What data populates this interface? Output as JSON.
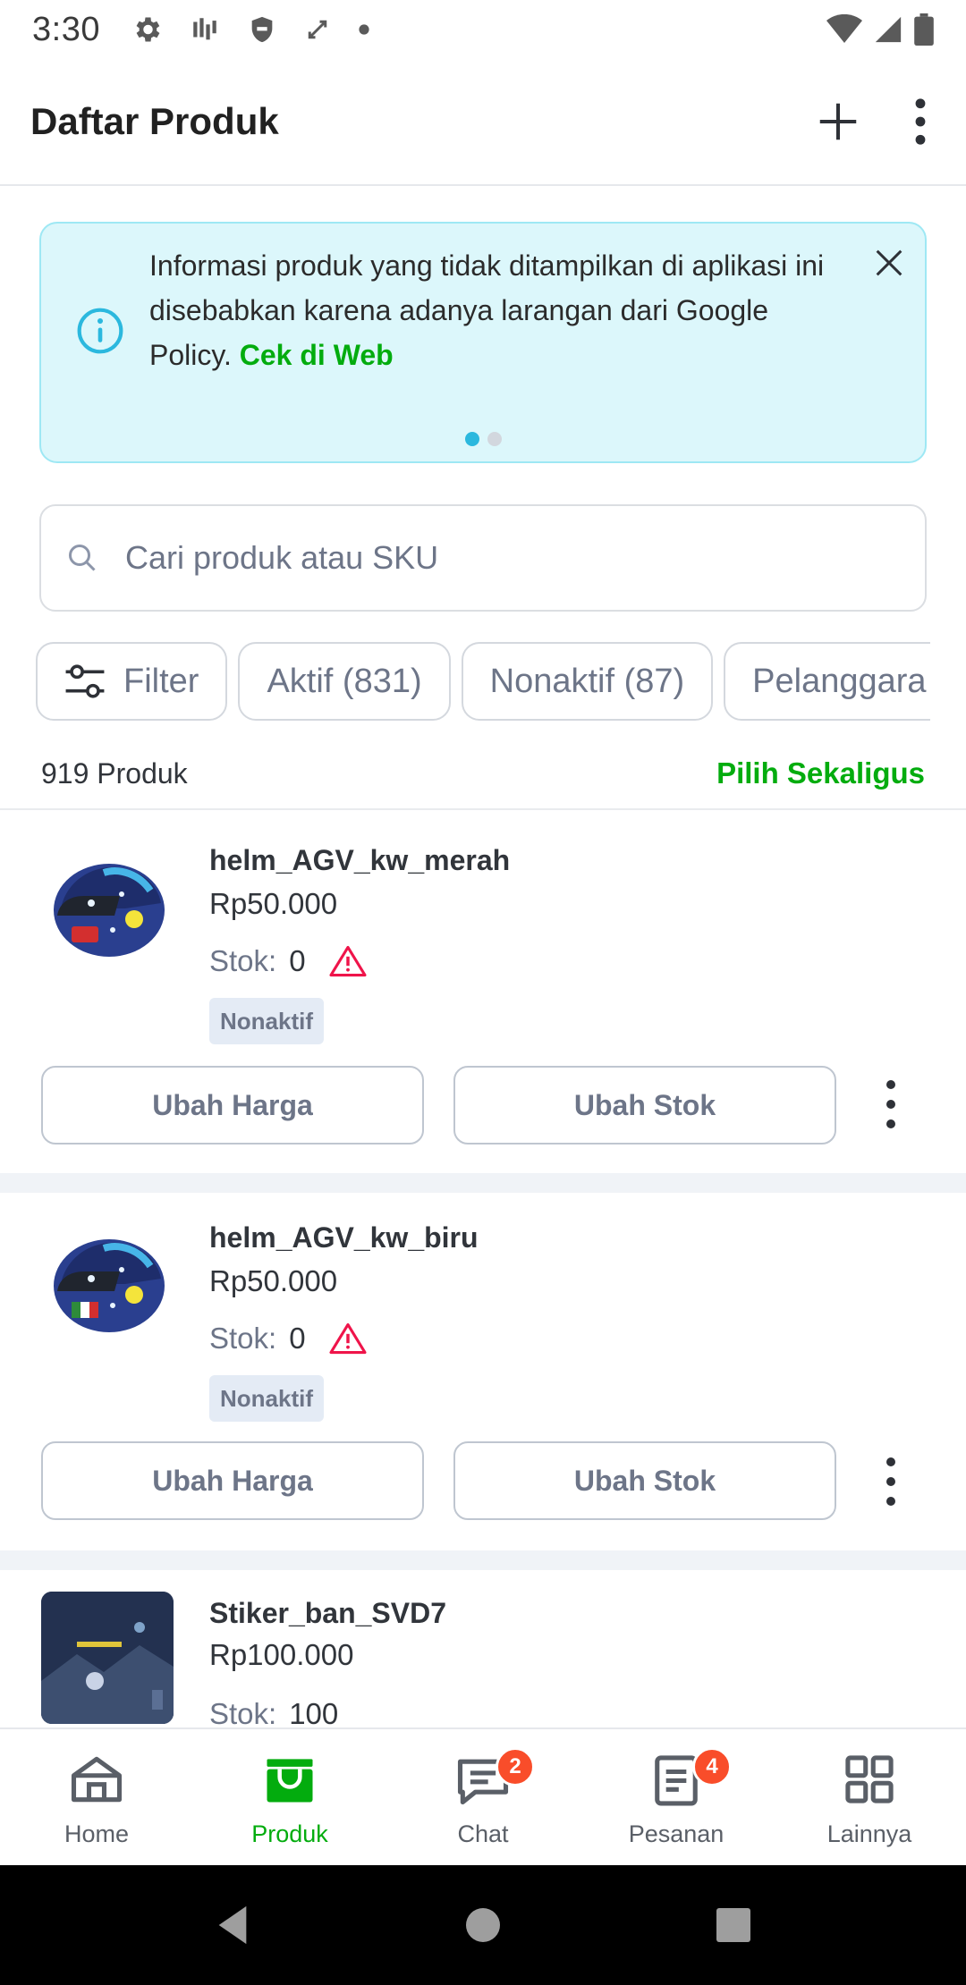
{
  "status_bar": {
    "time": "3:30",
    "icons": [
      "settings-icon",
      "signal-bars-icon",
      "shield-icon",
      "sync-icon",
      "dot-icon",
      "wifi-icon",
      "cell-signal-icon",
      "battery-icon"
    ]
  },
  "app_bar": {
    "title": "Daftar Produk",
    "add_icon": "plus-icon",
    "menu_icon": "more-vert-icon"
  },
  "banner": {
    "text": "Informasi produk yang tidak ditampilkan di aplikasi ini disebabkan karena adanya larangan dari Google Policy.",
    "link": "Cek di Web",
    "page_count": 2,
    "active_page": 1,
    "colors": {
      "background": "#dcf7fb",
      "accent": "#2bb8de",
      "link": "#03ac0e"
    }
  },
  "search": {
    "placeholder": "Cari produk atau SKU",
    "value": ""
  },
  "chips": [
    {
      "label": "Filter",
      "icon": "sliders-icon"
    },
    {
      "label": "Aktif (831)"
    },
    {
      "label": "Nonaktif (87)"
    },
    {
      "label": "Pelanggara"
    }
  ],
  "summary": {
    "count": "919 Produk",
    "select_all": "Pilih Sekaligus"
  },
  "products": [
    {
      "name": "helm_AGV_kw_merah",
      "price": "Rp50.000",
      "stock_label": "Stok:",
      "stock_value": "0",
      "status": "Nonaktif",
      "edit_price": "Ubah Harga",
      "edit_stock": "Ubah Stok"
    },
    {
      "name": "helm_AGV_kw_biru",
      "price": "Rp50.000",
      "stock_label": "Stok:",
      "stock_value": "0",
      "status": "Nonaktif",
      "edit_price": "Ubah Harga",
      "edit_stock": "Ubah Stok"
    },
    {
      "name": "Stiker_ban_SVD7",
      "price": "Rp100.000",
      "stock_label": "Stok:",
      "stock_value": "100"
    }
  ],
  "bottom_nav": [
    {
      "label": "Home",
      "icon": "home-icon"
    },
    {
      "label": "Produk",
      "icon": "store-icon",
      "active": true
    },
    {
      "label": "Chat",
      "icon": "chat-icon",
      "badge": "2"
    },
    {
      "label": "Pesanan",
      "icon": "orders-icon",
      "badge": "4"
    },
    {
      "label": "Lainnya",
      "icon": "grid-icon"
    }
  ],
  "colors": {
    "brand_green": "#03ac0e",
    "badge_red": "#f94d2a",
    "warning_red": "#ef144a"
  }
}
